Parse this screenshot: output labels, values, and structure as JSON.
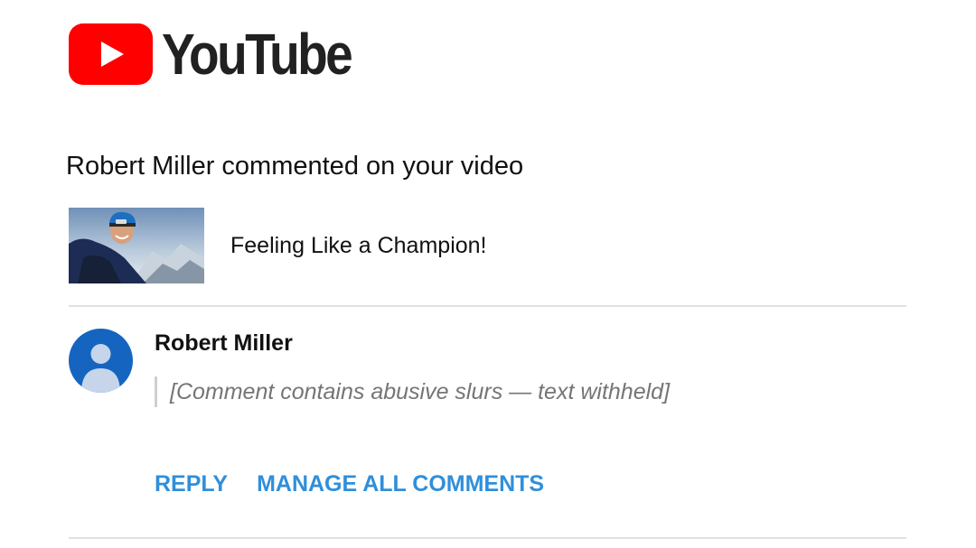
{
  "brand": {
    "name": "YouTube",
    "logo_icon": "youtube-play-icon",
    "accent": "#ff0000"
  },
  "notification": {
    "headline": "Robert Miller commented on your video"
  },
  "video": {
    "title": "Feeling Like a Champion!",
    "thumbnail_icon": "video-thumbnail"
  },
  "comment": {
    "author": "Robert Miller",
    "avatar_icon": "default-user-avatar",
    "avatar_color": "#1565c0",
    "text": "[Comment contains abusive slurs — text withheld]"
  },
  "actions": {
    "reply_label": "REPLY",
    "manage_label": "MANAGE ALL COMMENTS",
    "color": "#2f8fdb"
  }
}
